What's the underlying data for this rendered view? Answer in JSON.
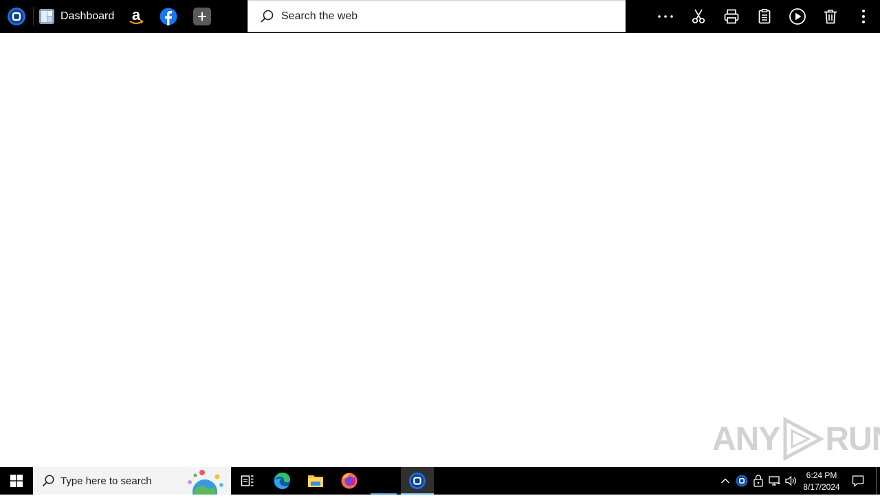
{
  "browser": {
    "app_icon": "app-logo-icon",
    "tabs": [
      {
        "label": "Dashboard",
        "icon": "dashboard-icon"
      }
    ],
    "favorites": [
      {
        "name": "amazon",
        "icon": "amazon-icon"
      },
      {
        "name": "facebook",
        "icon": "facebook-icon"
      }
    ],
    "new_tab_icon": "plus-icon",
    "search": {
      "placeholder": "Search the web",
      "value": ""
    },
    "toolbar": [
      "more-icon",
      "scissors-icon",
      "print-icon",
      "clipboard-icon",
      "play-icon",
      "trash-icon",
      "kebab-menu-icon"
    ]
  },
  "watermark": {
    "text": "ANY",
    "text2": "RUN"
  },
  "taskbar": {
    "search_placeholder": "Type here to search",
    "pinned": [
      "task-view-icon",
      "edge-icon",
      "file-explorer-icon",
      "firefox-icon",
      "app-logo-icon"
    ],
    "clock": {
      "time": "6:24 PM",
      "date": "8/17/2024"
    },
    "tray": [
      "chevron-up-icon",
      "app-logo-icon",
      "lock-icon",
      "network-icon",
      "volume-icon",
      "notification-icon"
    ]
  },
  "colors": {
    "top_bar": "#000000",
    "taskbar": "#000000",
    "accent": "#1e6fd9",
    "page_background": "#ffffff"
  }
}
